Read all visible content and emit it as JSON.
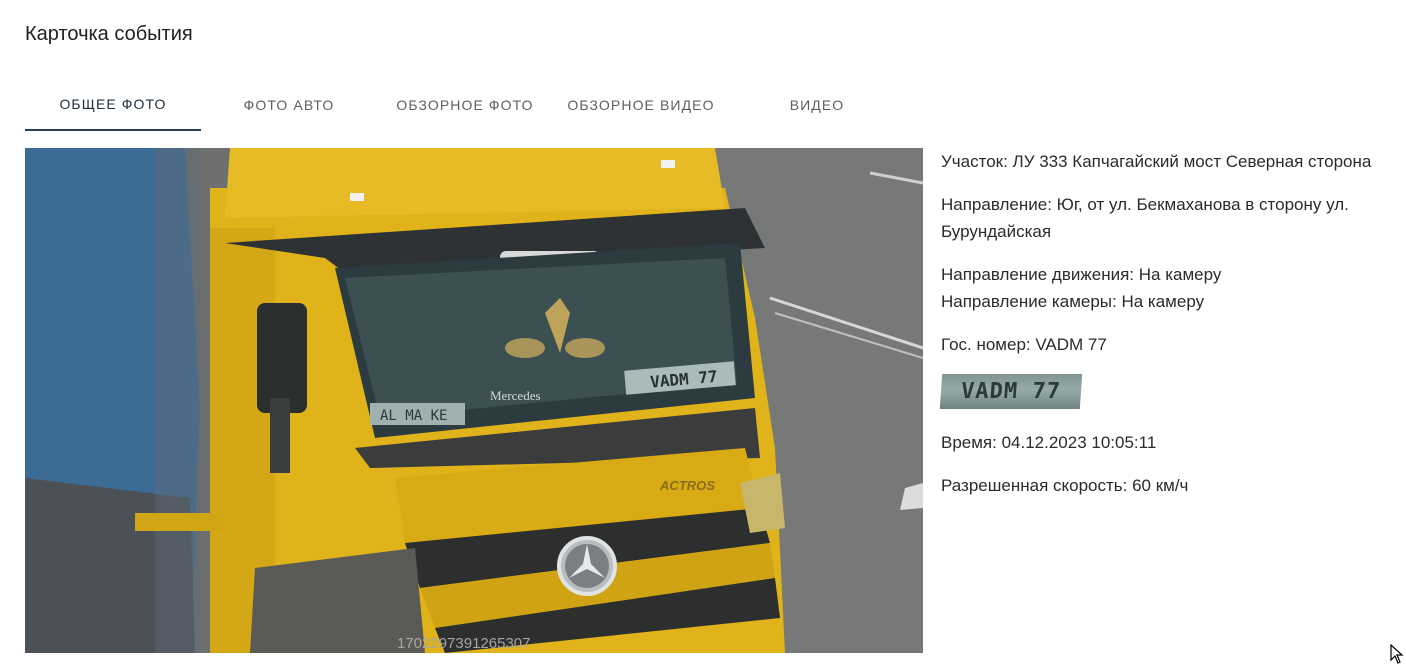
{
  "title": "Карточка события",
  "tabs": [
    {
      "label": "ОБЩЕЕ ФОТО",
      "active": true
    },
    {
      "label": "ФОТО АВТО",
      "active": false
    },
    {
      "label": "ОБЗОРНОЕ ФОТО",
      "active": false
    },
    {
      "label": "ОБЗОРНОЕ ВИДЕО",
      "active": false
    },
    {
      "label": "ВИДЕО",
      "active": false
    }
  ],
  "photo": {
    "timestamp_overlay": "1702297391265307",
    "plate_text": "VADM 77",
    "lower_plate_text": "AL MA KE",
    "brand_text": "Mercedes",
    "model_text": "ACTROS"
  },
  "info": {
    "section": "Участок: ЛУ 333 Капчагайский мост Северная сторона",
    "direction": "Направление: Юг, от ул. Бекмаханова в сторону ул. Бурундайская",
    "movement_direction": "Направление движения: На камеру",
    "camera_direction": "Направление камеры: На камеру",
    "plate_number": "Гос. номер: VADM 77",
    "plate_crop_text": "VADM 77",
    "time": "Время: 04.12.2023 10:05:11",
    "speed_limit": "Разрешенная скорость: 60 км/ч"
  },
  "colors": {
    "active_tab_underline": "#2b4256",
    "truck_yellow": "#e2b41a",
    "trailer_blue": "#3b6f99"
  },
  "icons": [
    "mouse-cursor-icon"
  ]
}
